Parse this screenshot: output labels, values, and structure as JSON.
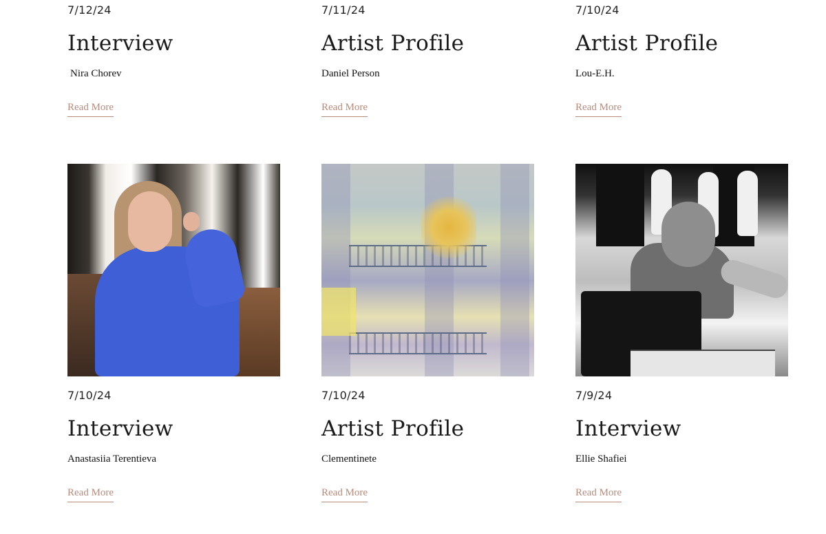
{
  "read_more_label": "Read More",
  "colors": {
    "accent": "#b88a7a",
    "heading": "#1a1a1a",
    "text": "#111111"
  },
  "posts_top": [
    {
      "date": "7/12/24",
      "category": "Interview",
      "author": "Nira Chorev"
    },
    {
      "date": "7/11/24",
      "category": "Artist Profile",
      "author": "Daniel Person"
    },
    {
      "date": "7/10/24",
      "category": "Artist Profile",
      "author": "Lou-E.H."
    }
  ],
  "posts_bottom": [
    {
      "date": "7/10/24",
      "category": "Interview",
      "author": "Anastasiia Terentieva"
    },
    {
      "date": "7/10/24",
      "category": "Artist Profile",
      "author": "Clementinete"
    },
    {
      "date": "7/9/24",
      "category": "Interview",
      "author": "Ellie Shafiei"
    }
  ]
}
